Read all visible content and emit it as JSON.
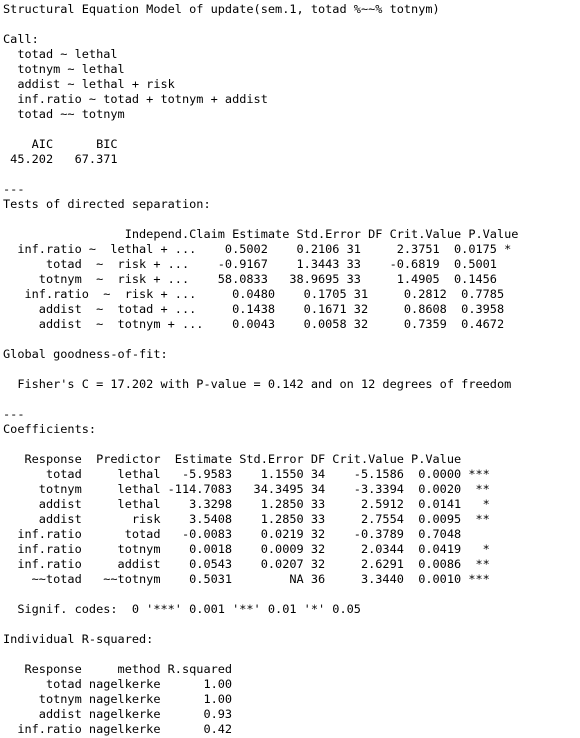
{
  "console": {
    "lines": [
      "Structural Equation Model of update(sem.1, totad %~~% totnym)",
      "",
      "Call:",
      "  totad ~ lethal",
      "  totnym ~ lethal",
      "  addist ~ lethal + risk",
      "  inf.ratio ~ totad + totnym + addist",
      "  totad ~~ totnym",
      "",
      "    AIC      BIC",
      " 45.202   67.371",
      "",
      "---",
      "Tests of directed separation:",
      "",
      "                 Independ.Claim Estimate Std.Error DF Crit.Value P.Value  ",
      "  inf.ratio ~  lethal + ...    0.5002    0.2106 31     2.3751  0.0175 * ",
      "      totad  ~  risk + ...    -0.9167    1.3443 33    -0.6819  0.5001   ",
      "     totnym  ~  risk + ...    58.0833   38.9695 33     1.4905  0.1456   ",
      "   inf.ratio  ~  risk + ...     0.0480    0.1705 31     0.2812  0.7785   ",
      "     addist  ~  totad + ...     0.1438    0.1671 32     0.8608  0.3958   ",
      "     addist  ~  totnym + ...    0.0043    0.0058 32     0.7359  0.4672   ",
      "",
      "Global goodness-of-fit:",
      "",
      "  Fisher's C = 17.202 with P-value = 0.142 and on 12 degrees of freedom",
      "",
      "---",
      "Coefficients:",
      "",
      "   Response  Predictor  Estimate Std.Error DF Crit.Value P.Value    ",
      "      totad     lethal   -5.9583    1.1550 34    -5.1586  0.0000 ***",
      "     totnym     lethal -114.7083   34.3495 34    -3.3394  0.0020  **",
      "     addist     lethal    3.3298    1.2850 33     2.5912  0.0141   *",
      "     addist       risk    3.5408    1.2850 33     2.7554  0.0095  **",
      "  inf.ratio      totad   -0.0083    0.0219 32    -0.3789  0.7048    ",
      "  inf.ratio     totnym    0.0018    0.0009 32     2.0344  0.0419   *",
      "  inf.ratio     addist    0.0543    0.0207 32     2.6291  0.0086  **",
      "    ~~totad   ~~totnym    0.5031        NA 36     3.3440  0.0010 ***",
      "",
      "  Signif. codes:  0 '***' 0.001 '**' 0.01 '*' 0.05",
      "",
      "Individual R-squared:",
      "",
      "   Response     method R.squared",
      "      totad nagelkerke      1.00",
      "     totnym nagelkerke      1.00",
      "     addist nagelkerke      0.93",
      "  inf.ratio nagelkerke      0.42"
    ]
  }
}
